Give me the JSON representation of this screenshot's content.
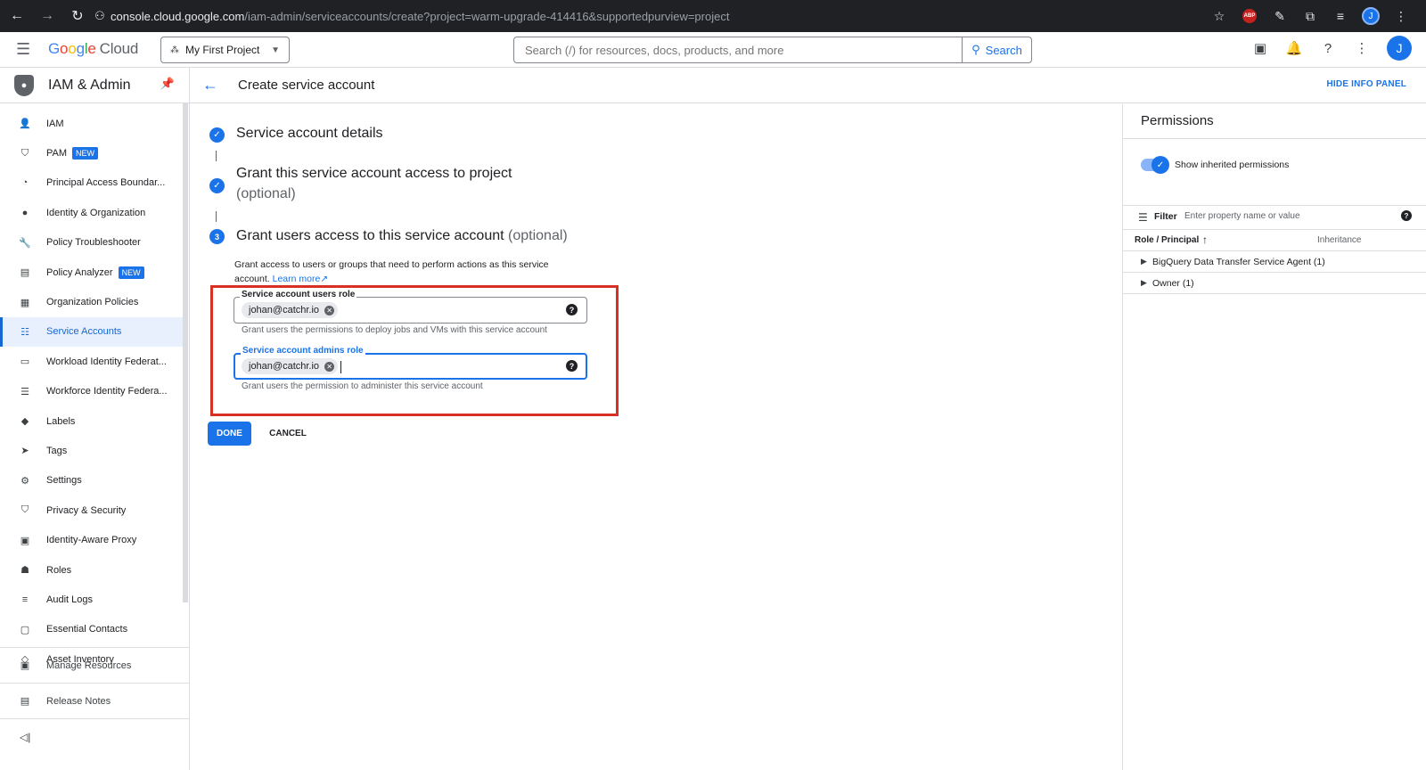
{
  "browser": {
    "url_host": "console.cloud.google.com",
    "url_path": "/iam-admin/serviceaccounts/create?project=warm-upgrade-414416&supportedpurview=project",
    "abp_label": "ABP",
    "profile_initial": "J"
  },
  "header": {
    "logo_google": [
      "G",
      "o",
      "o",
      "g",
      "l",
      "e"
    ],
    "logo_cloud": "Cloud",
    "project": "My First Project",
    "search_placeholder": "Search (/) for resources, docs, products, and more",
    "search_button": "Search",
    "avatar_initial": "J"
  },
  "sidebar": {
    "title": "IAM & Admin",
    "items": [
      {
        "label": "IAM",
        "icon": "person-add-icon",
        "glyph": "👤"
      },
      {
        "label": "PAM",
        "icon": "pam-shield-icon",
        "glyph": "⛉",
        "badge": "NEW"
      },
      {
        "label": "Principal Access Boundar...",
        "icon": "boundary-icon",
        "glyph": "◔"
      },
      {
        "label": "Identity & Organization",
        "icon": "account-circle-icon",
        "glyph": "●"
      },
      {
        "label": "Policy Troubleshooter",
        "icon": "wrench-icon",
        "glyph": "🔧"
      },
      {
        "label": "Policy Analyzer",
        "icon": "analyzer-icon",
        "glyph": "▤",
        "badge": "NEW"
      },
      {
        "label": "Organization Policies",
        "icon": "policies-icon",
        "glyph": "▦"
      },
      {
        "label": "Service Accounts",
        "icon": "service-accounts-icon",
        "glyph": "☷",
        "active": true
      },
      {
        "label": "Workload Identity Federat...",
        "icon": "workload-id-icon",
        "glyph": "▭"
      },
      {
        "label": "Workforce Identity Federa...",
        "icon": "workforce-list-icon",
        "glyph": "☰"
      },
      {
        "label": "Labels",
        "icon": "label-icon",
        "glyph": "◆"
      },
      {
        "label": "Tags",
        "icon": "tag-icon",
        "glyph": "➤"
      },
      {
        "label": "Settings",
        "icon": "gear-icon",
        "glyph": "⚙"
      },
      {
        "label": "Privacy & Security",
        "icon": "shield-icon",
        "glyph": "⛉"
      },
      {
        "label": "Identity-Aware Proxy",
        "icon": "proxy-icon",
        "glyph": "▣"
      },
      {
        "label": "Roles",
        "icon": "roles-icon",
        "glyph": "☗"
      },
      {
        "label": "Audit Logs",
        "icon": "audit-logs-icon",
        "glyph": "≡"
      },
      {
        "label": "Essential Contacts",
        "icon": "contacts-icon",
        "glyph": "▢"
      },
      {
        "label": "Asset Inventory",
        "icon": "asset-inventory-icon",
        "glyph": "◇"
      }
    ],
    "bottom": [
      {
        "label": "Manage Resources",
        "icon": "manage-resources-icon",
        "glyph": "▣"
      },
      {
        "label": "Release Notes",
        "icon": "release-notes-icon",
        "glyph": "▤"
      }
    ]
  },
  "page": {
    "title": "Create service account",
    "hide_info_panel": "HIDE INFO PANEL"
  },
  "steps": {
    "step1": {
      "title": "Service account details"
    },
    "step2": {
      "title": "Grant this service account access to project",
      "optional": "(optional)"
    },
    "step3": {
      "number": "3",
      "title": "Grant users access to this service account",
      "optional": "(optional)",
      "description": "Grant access to users or groups that need to perform actions as this service account.",
      "learn_more": "Learn more"
    }
  },
  "fields": {
    "users_role": {
      "label": "Service account users role",
      "chip": "johan@catchr.io",
      "hint": "Grant users the permissions to deploy jobs and VMs with this service account"
    },
    "admins_role": {
      "label": "Service account admins role",
      "chip": "johan@catchr.io",
      "hint": "Grant users the permission to administer this service account"
    }
  },
  "actions": {
    "done": "DONE",
    "cancel": "CANCEL"
  },
  "info_panel": {
    "title": "Permissions",
    "toggle_label": "Show inherited permissions",
    "filter_label": "Filter",
    "filter_placeholder": "Enter property name or value",
    "col_role": "Role / Principal",
    "col_inheritance": "Inheritance",
    "rows": [
      "BigQuery Data Transfer Service Agent (1)",
      "Owner (1)"
    ]
  },
  "colors": {
    "accent": "#1a73e8",
    "highlight_box": "#d93025"
  }
}
